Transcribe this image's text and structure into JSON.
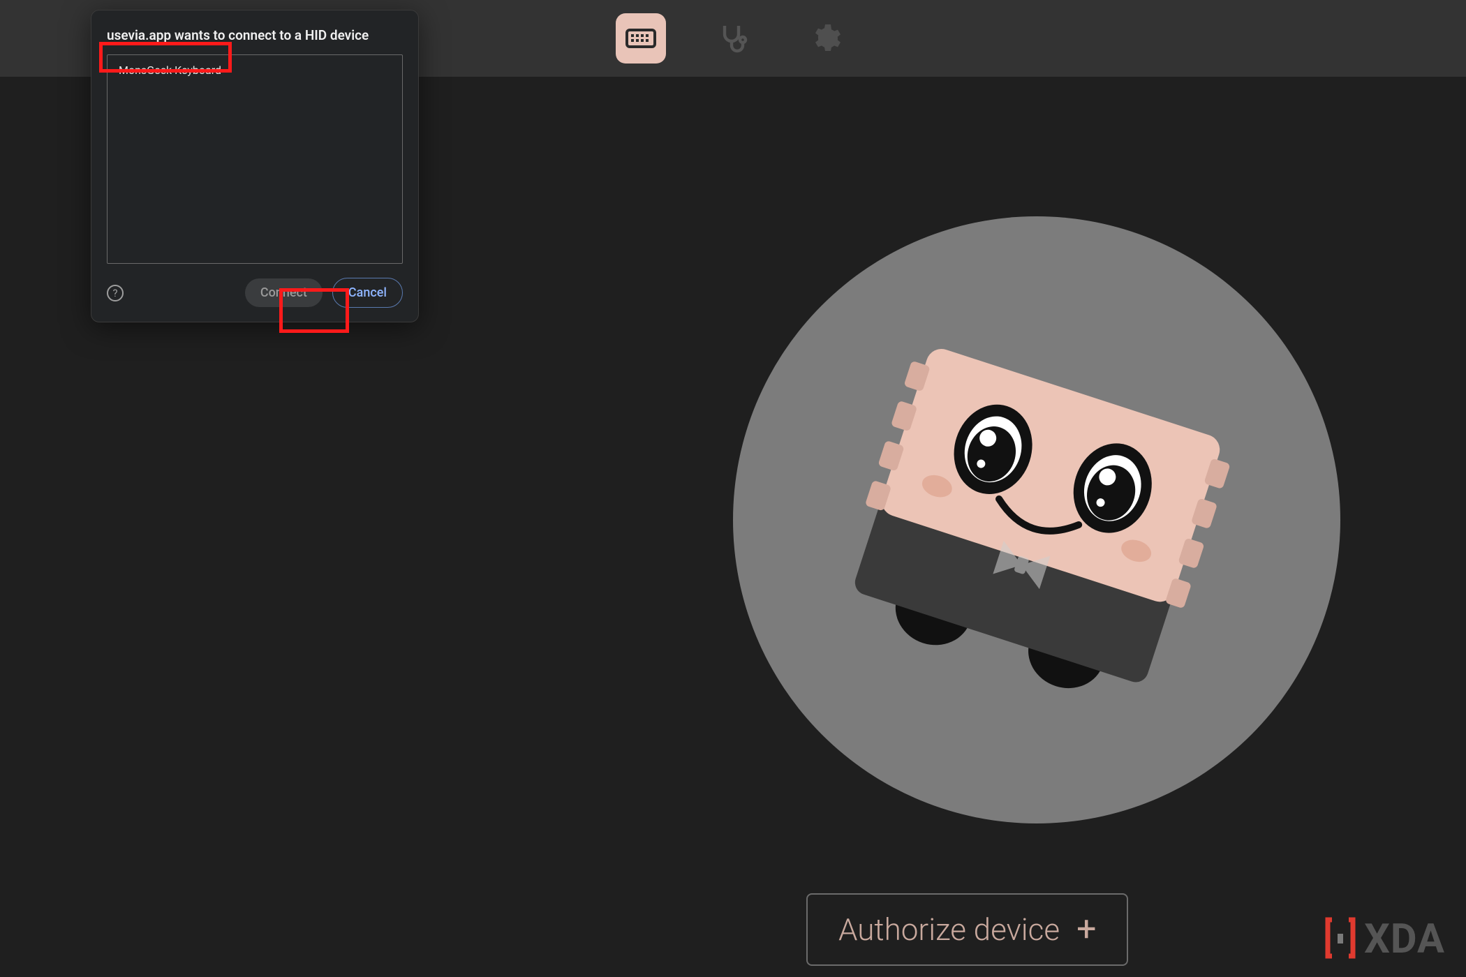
{
  "nav": {
    "items": [
      {
        "name": "configure",
        "active": true
      },
      {
        "name": "key-tester",
        "active": false
      },
      {
        "name": "settings",
        "active": false
      }
    ]
  },
  "hid_dialog": {
    "title": "usevia.app wants to connect to a HID device",
    "devices": [
      {
        "label": "MonsGeek Keyboard"
      }
    ],
    "connect_label": "Connect",
    "cancel_label": "Cancel",
    "help_glyph": "?"
  },
  "main": {
    "authorize_label": "Authorize device",
    "authorize_plus": "+"
  },
  "watermark": {
    "text": "XDA"
  }
}
